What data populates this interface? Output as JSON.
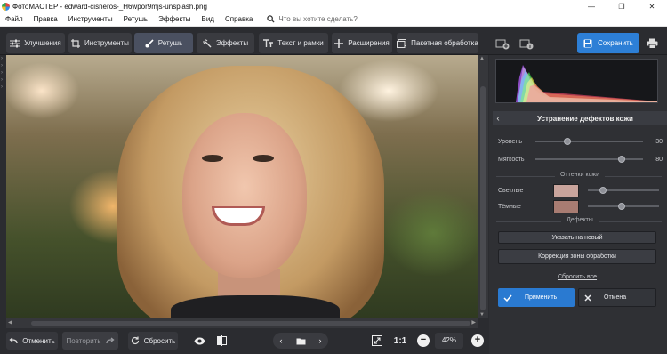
{
  "window": {
    "title": "ФотоМАСТЕР - edward-cisneros-_H6wpor9mjs-unsplash.png",
    "controls": [
      "—",
      "❐",
      "✕"
    ]
  },
  "menu": {
    "items": [
      "Файл",
      "Правка",
      "Инструменты",
      "Ретушь",
      "Эффекты",
      "Вид",
      "Справка"
    ],
    "search_placeholder": "Что вы хотите сделать?"
  },
  "toolbar": {
    "tabs": [
      {
        "label": "Улучшения",
        "icon": "sliders-icon"
      },
      {
        "label": "Инструменты",
        "icon": "crop-icon"
      },
      {
        "label": "Ретушь",
        "icon": "brush-icon",
        "active": true
      },
      {
        "label": "Эффекты",
        "icon": "magic-wand-icon"
      },
      {
        "label": "Текст и рамки",
        "icon": "text-icon"
      },
      {
        "label": "Расширения",
        "icon": "plus-icon"
      }
    ],
    "batch_label": "Пакетная обработка",
    "save_label": "Сохранить"
  },
  "panel": {
    "title": "Устранение дефектов кожи",
    "level_label": "Уровень",
    "level_value": "30",
    "level_fraction": 0.3,
    "softness_label": "Мягкость",
    "softness_value": "80",
    "softness_fraction": 0.8,
    "skin_tones_title": "Оттенки кожи",
    "light_label": "Светлые",
    "light_color": "#c9a49c",
    "dark_label": "Тёмные",
    "dark_color": "#a87c72",
    "defects_title": "Дефекты",
    "point_new_label": "Указать на новый",
    "correction_zone_label": "Коррекция зоны обработки",
    "reset_all_label": "Сбросить все",
    "apply_label": "Применить",
    "cancel_label": "Отмена"
  },
  "bottom": {
    "undo_label": "Отменить",
    "redo_label": "Повторить",
    "reset_label": "Сбросить",
    "fit_label": "1:1",
    "zoom_value": "42%"
  },
  "colors": {
    "accent": "#2d7fd6",
    "background": "#2b2c30"
  }
}
